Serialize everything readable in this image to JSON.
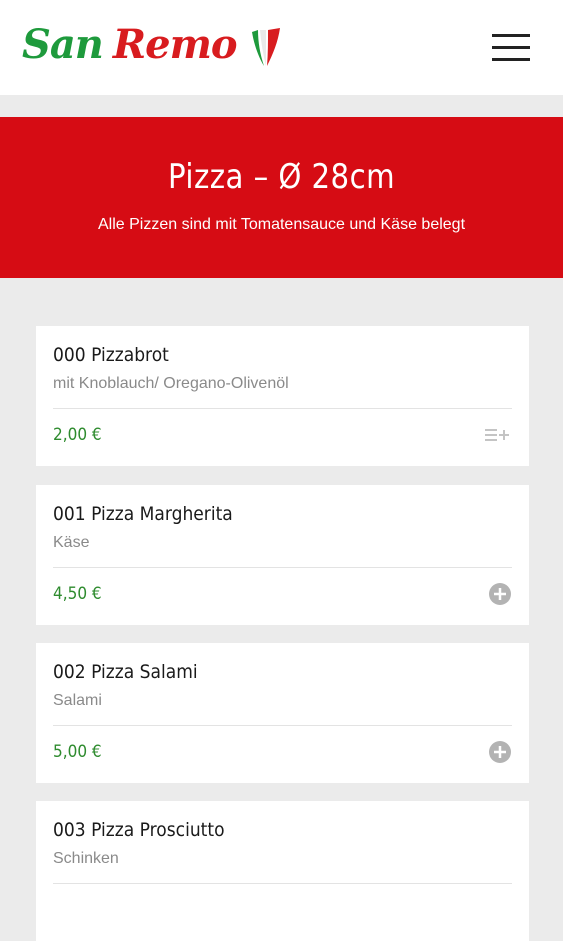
{
  "header": {
    "logo_word1": "San",
    "logo_word2": "Remo",
    "menu_icon": "hamburger-menu-icon"
  },
  "hero": {
    "title": "Pizza – Ø 28cm",
    "subtitle": "Alle Pizzen sind mit Tomatensauce und Käse belegt",
    "background": "#d60c14"
  },
  "colors": {
    "price": "#2e8b2e",
    "logo_green": "#1e9a3c",
    "logo_red": "#d81c1f"
  },
  "items": [
    {
      "name": "000 Pizzabrot",
      "description": "mit Knoblauch/ Oregano-Olivenöl",
      "price": "2,00 €",
      "action_icon": "list-add-icon"
    },
    {
      "name": "001 Pizza Margherita",
      "description": "Käse",
      "price": "4,50 €",
      "action_icon": "plus-circle-icon"
    },
    {
      "name": "002 Pizza Salami",
      "description": "Salami",
      "price": "5,00 €",
      "action_icon": "plus-circle-icon"
    },
    {
      "name": "003 Pizza Prosciutto",
      "description": "Schinken",
      "price": "",
      "action_icon": "plus-circle-icon"
    }
  ]
}
